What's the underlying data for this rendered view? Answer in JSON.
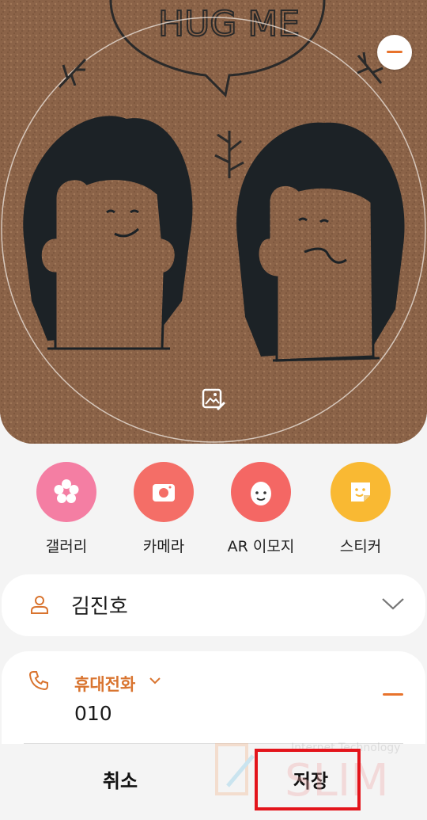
{
  "photo": {
    "image": "hedgehog-cork-photo",
    "visible_text": "HUG ME",
    "remove_icon": "minus-circle-icon",
    "edit_icon": "edit-image-icon"
  },
  "sources": [
    {
      "label": "갤러리",
      "icon": "flower-icon",
      "color": "#f47ea3"
    },
    {
      "label": "카메라",
      "icon": "camera-icon",
      "color": "#f46e67"
    },
    {
      "label": "AR 이모지",
      "icon": "face-icon",
      "color": "#f46764"
    },
    {
      "label": "스티커",
      "icon": "sticker-icon",
      "color": "#f9b933"
    }
  ],
  "name_field": {
    "icon": "user-icon",
    "value": "김진호",
    "expand_icon": "chevron-down-icon"
  },
  "phone_field": {
    "icon": "phone-icon",
    "type_label": "휴대전화",
    "value": "010",
    "remove_icon": "minus-icon",
    "accent": "#d9742f"
  },
  "actions": {
    "cancel": "취소",
    "save": "저장"
  },
  "highlight_color": "#e3141b",
  "watermark": {
    "text": "SLIM",
    "subtitle": "Internet Technology"
  }
}
